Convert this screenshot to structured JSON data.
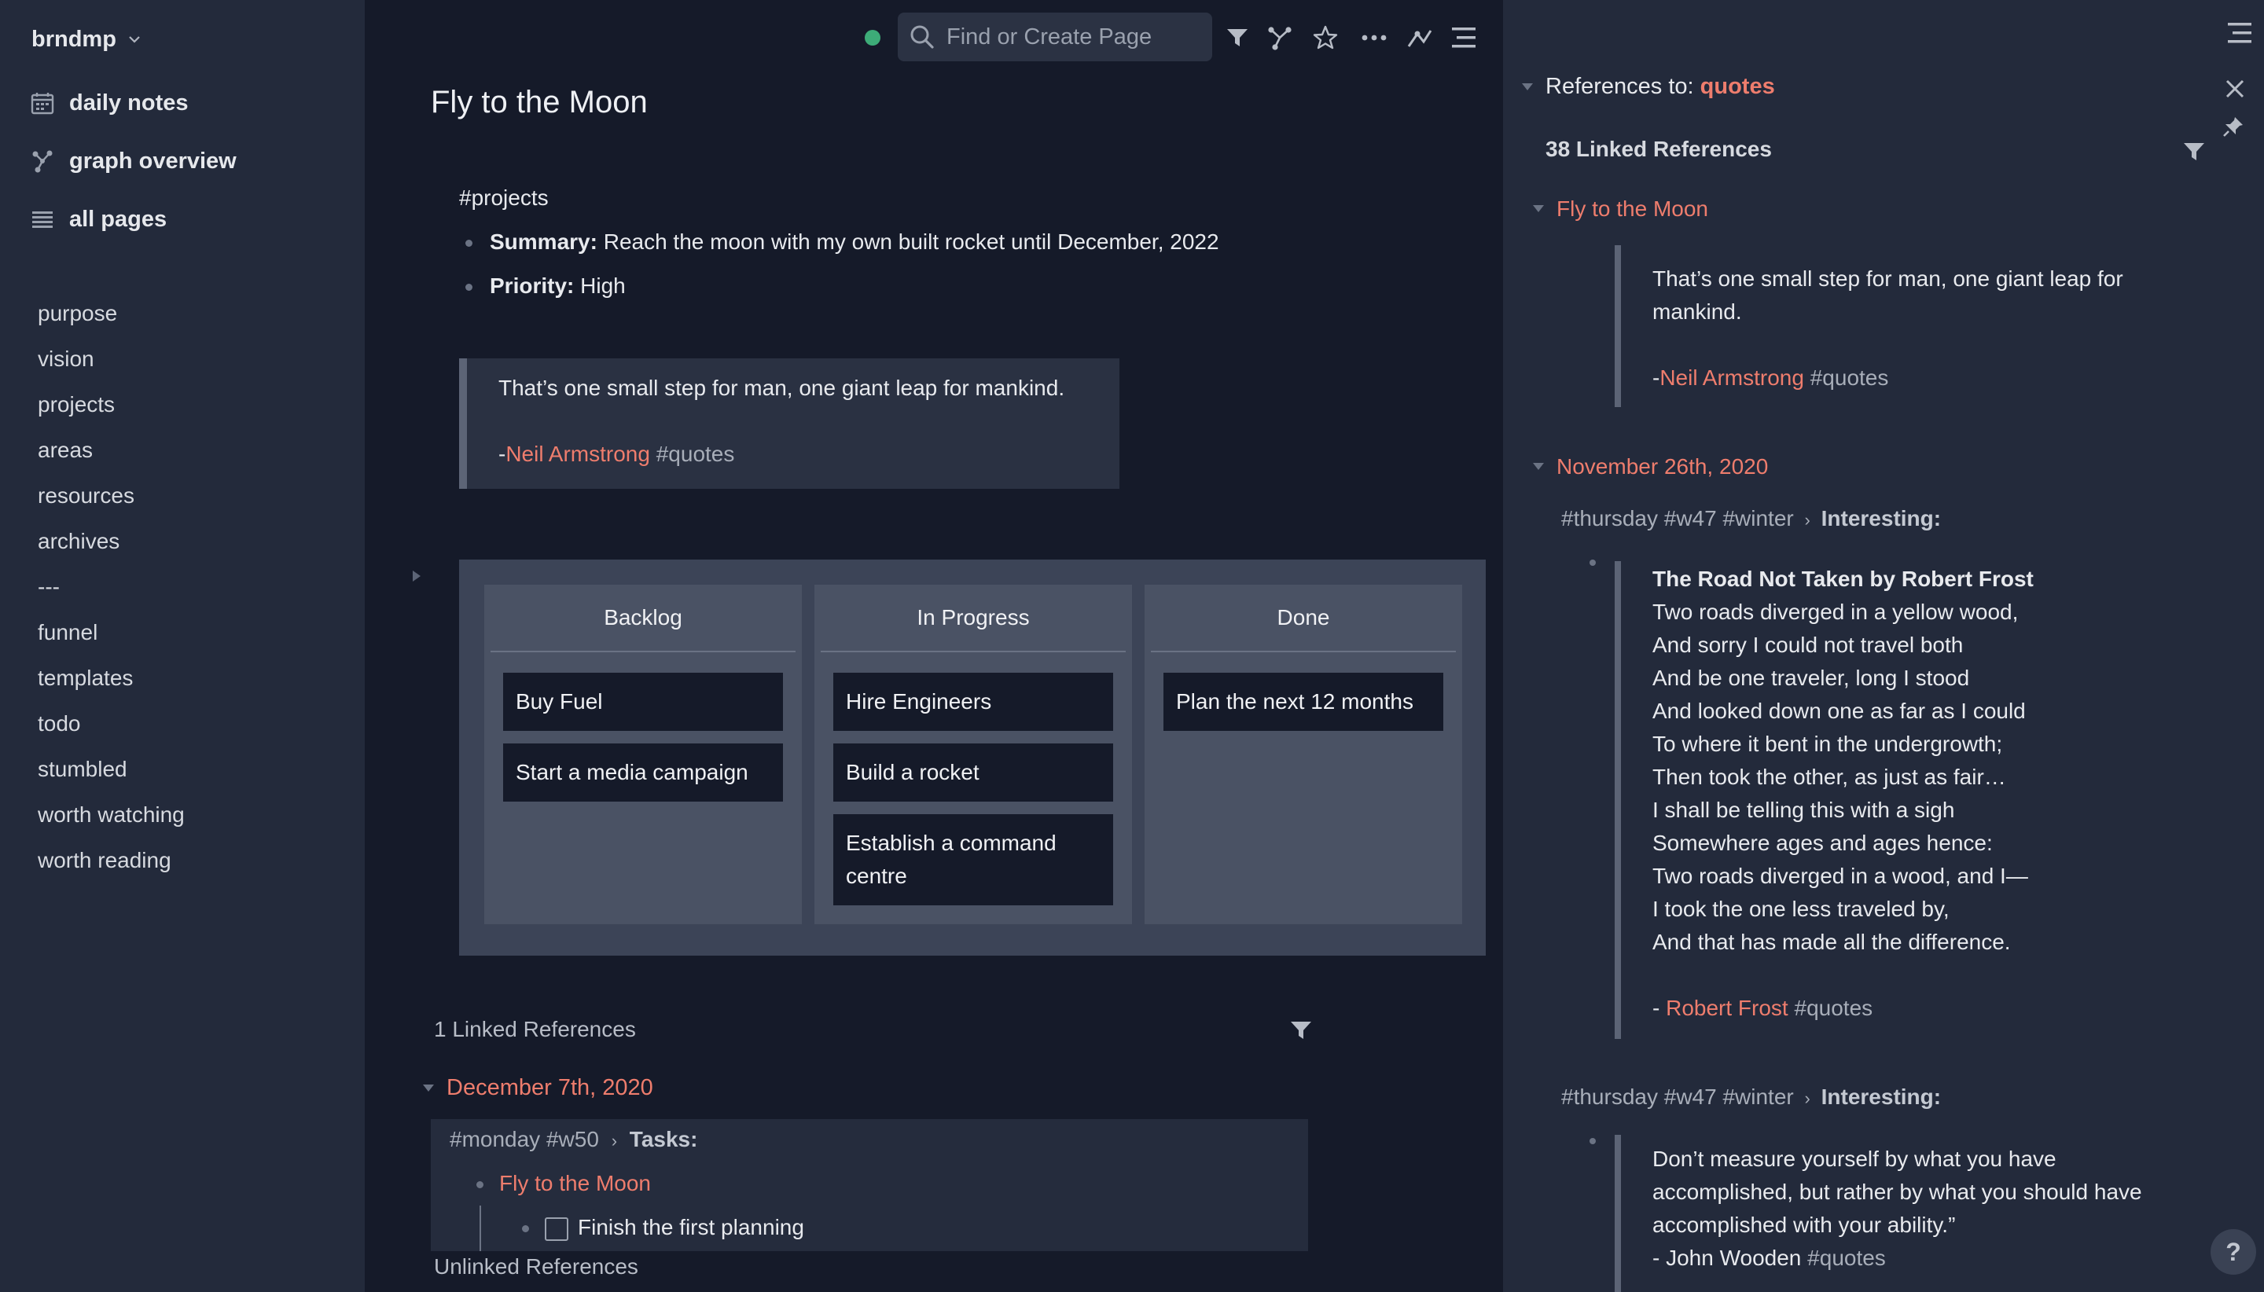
{
  "sidebar": {
    "graph_name": "brndmp",
    "nav": [
      {
        "label": "daily notes"
      },
      {
        "label": "graph overview"
      },
      {
        "label": "all pages"
      }
    ],
    "shortcuts": [
      "purpose",
      "vision",
      "projects",
      "areas",
      "resources",
      "archives",
      "---",
      "funnel",
      "templates",
      "todo",
      "stumbled",
      "worth watching",
      "worth reading"
    ]
  },
  "topbar": {
    "search_placeholder": "Find or Create Page",
    "sync_color": "#3dac78"
  },
  "page": {
    "title": "Fly to the Moon",
    "tag": "#projects",
    "summary_label": "Summary:",
    "summary_text": " Reach the moon with my own built rocket until December, 2022",
    "priority_label": "Priority:",
    "priority_text": " High",
    "quote": {
      "text": "That’s one small step for man, one giant leap for mankind.",
      "dash": "-",
      "author": "Neil Armstrong",
      "tag": " #quotes"
    },
    "kanban": [
      {
        "title": "Backlog",
        "cards": [
          "Buy Fuel",
          "Start a media campaign"
        ]
      },
      {
        "title": "In Progress",
        "cards": [
          "Hire Engineers",
          "Build a rocket",
          "Establish a command centre"
        ]
      },
      {
        "title": "Done",
        "cards": [
          "Plan the next 12 months"
        ]
      }
    ],
    "linked_refs": {
      "heading": "1 Linked References",
      "date": "December 7th, 2020",
      "breadcrumb_tags": "#monday #w50",
      "breadcrumb_sep": "›",
      "breadcrumb_target": "Tasks:",
      "child_ref": "Fly to the Moon",
      "todo_text": "Finish the first planning"
    },
    "unlinked_heading": "Unlinked References"
  },
  "right_sidebar": {
    "refs_prefix": "References to: ",
    "refs_page": "quotes",
    "linked_count": "38 Linked References",
    "group1": {
      "title": "Fly to the Moon",
      "quote_line1": "That’s one small step for man, one giant leap for",
      "quote_line2": "mankind.",
      "dash": "-",
      "author": "Neil Armstrong",
      "tag": " #quotes"
    },
    "group2": {
      "title": "November 26th, 2020",
      "crumb_tags": "#thursday #w47 #winter",
      "crumb_sep": "›",
      "crumb_target": "Interesting:",
      "poem_title": "The Road Not Taken by Robert Frost",
      "poem_lines": [
        "Two roads diverged in a yellow wood,",
        "And sorry I could not travel both",
        "And be one traveler, long I stood",
        "And looked down one as far as I could",
        "To where it bent in the undergrowth;",
        "Then took the other, as just as fair…",
        "I shall be telling this with a sigh",
        "Somewhere ages and ages hence:",
        "Two roads diverged in a wood, and I—",
        "I took the one less traveled by,",
        "And that has made all the difference."
      ],
      "poem_dash": "- ",
      "poem_author": "Robert Frost",
      "poem_tag": " #quotes",
      "crumb2_tags": "#thursday #w47 #winter",
      "crumb2_target": "Interesting:",
      "wooden_lines": [
        "Don’t measure yourself by what you have",
        "accomplished, but rather by what you should have",
        "accomplished with your ability.”"
      ],
      "wooden_author": "- John Wooden",
      "wooden_tag": " #quotes"
    }
  },
  "help_label": "?"
}
